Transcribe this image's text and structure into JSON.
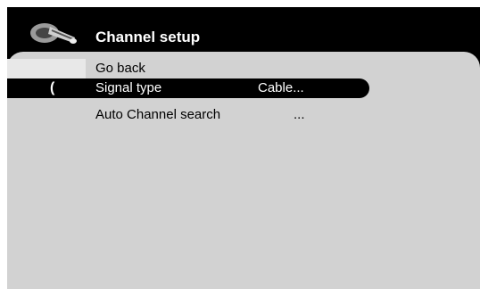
{
  "screen": {
    "title": "Channel setup",
    "icon": "channel-setup-icon"
  },
  "menu": {
    "items": [
      {
        "label": "Go back",
        "value": ""
      },
      {
        "label": "Signal type",
        "value": "Cable..."
      },
      {
        "label": "Auto Channel search",
        "value": "..."
      }
    ],
    "selected_index": 1,
    "selection_marker": "("
  },
  "colors": {
    "frame": "#000000",
    "panel": "#d2d2d2",
    "highlight": "#000000",
    "text": "#000000",
    "selected_text": "#ffffff"
  }
}
